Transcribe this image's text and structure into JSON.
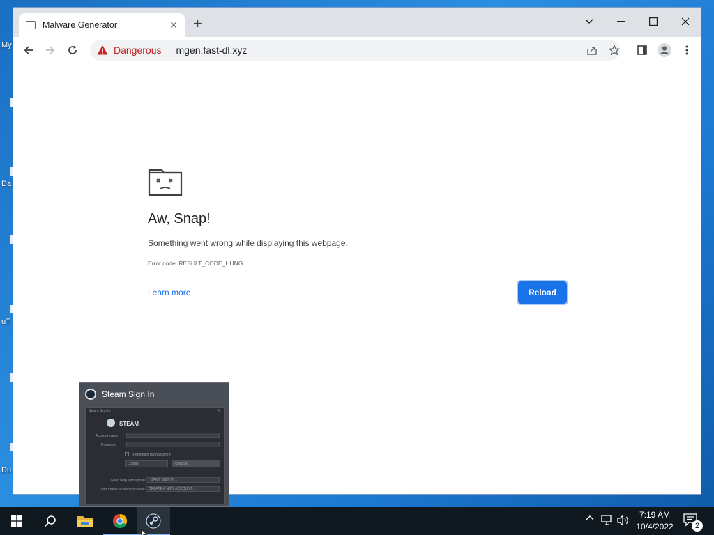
{
  "desktop": {
    "labels": [
      "My",
      "Da",
      "uT",
      "Du"
    ]
  },
  "browser": {
    "tab": {
      "title": "Malware Generator",
      "close_glyph": "✕"
    },
    "new_tab_glyph": "+",
    "window_controls": {
      "dropdown": "⌄",
      "minimize": "—",
      "maximize": "☐",
      "close": "✕"
    },
    "omnibox": {
      "security_label": "Dangerous",
      "url": "mgen.fast-dl.xyz"
    },
    "accent_color": "#1a73e8",
    "danger_color": "#c5221f"
  },
  "error_page": {
    "title": "Aw, Snap!",
    "description": "Something went wrong while displaying this webpage.",
    "error_code": "Error code: RESULT_CODE_HUNG",
    "learn_more": "Learn more",
    "reload": "Reload"
  },
  "steam_preview": {
    "title": "Steam Sign In",
    "mini": {
      "window_title": "Steam Sign In",
      "brand": "STEAM",
      "account_label": "Account name",
      "password_label": "Password",
      "remember_label": "Remember my password",
      "login_button": "LOGIN",
      "cancel_button": "CANCEL",
      "help_question": "Need help with sign in?",
      "help_link": "I CAN'T SIGN IN...",
      "create_question": "Don't have a Steam account?",
      "create_link": "CREATE A NEW ACCOUNT..."
    }
  },
  "taskbar": {
    "time": "7:19 AM",
    "date": "10/4/2022",
    "notification_count": "2",
    "tray_chevron": "^"
  }
}
